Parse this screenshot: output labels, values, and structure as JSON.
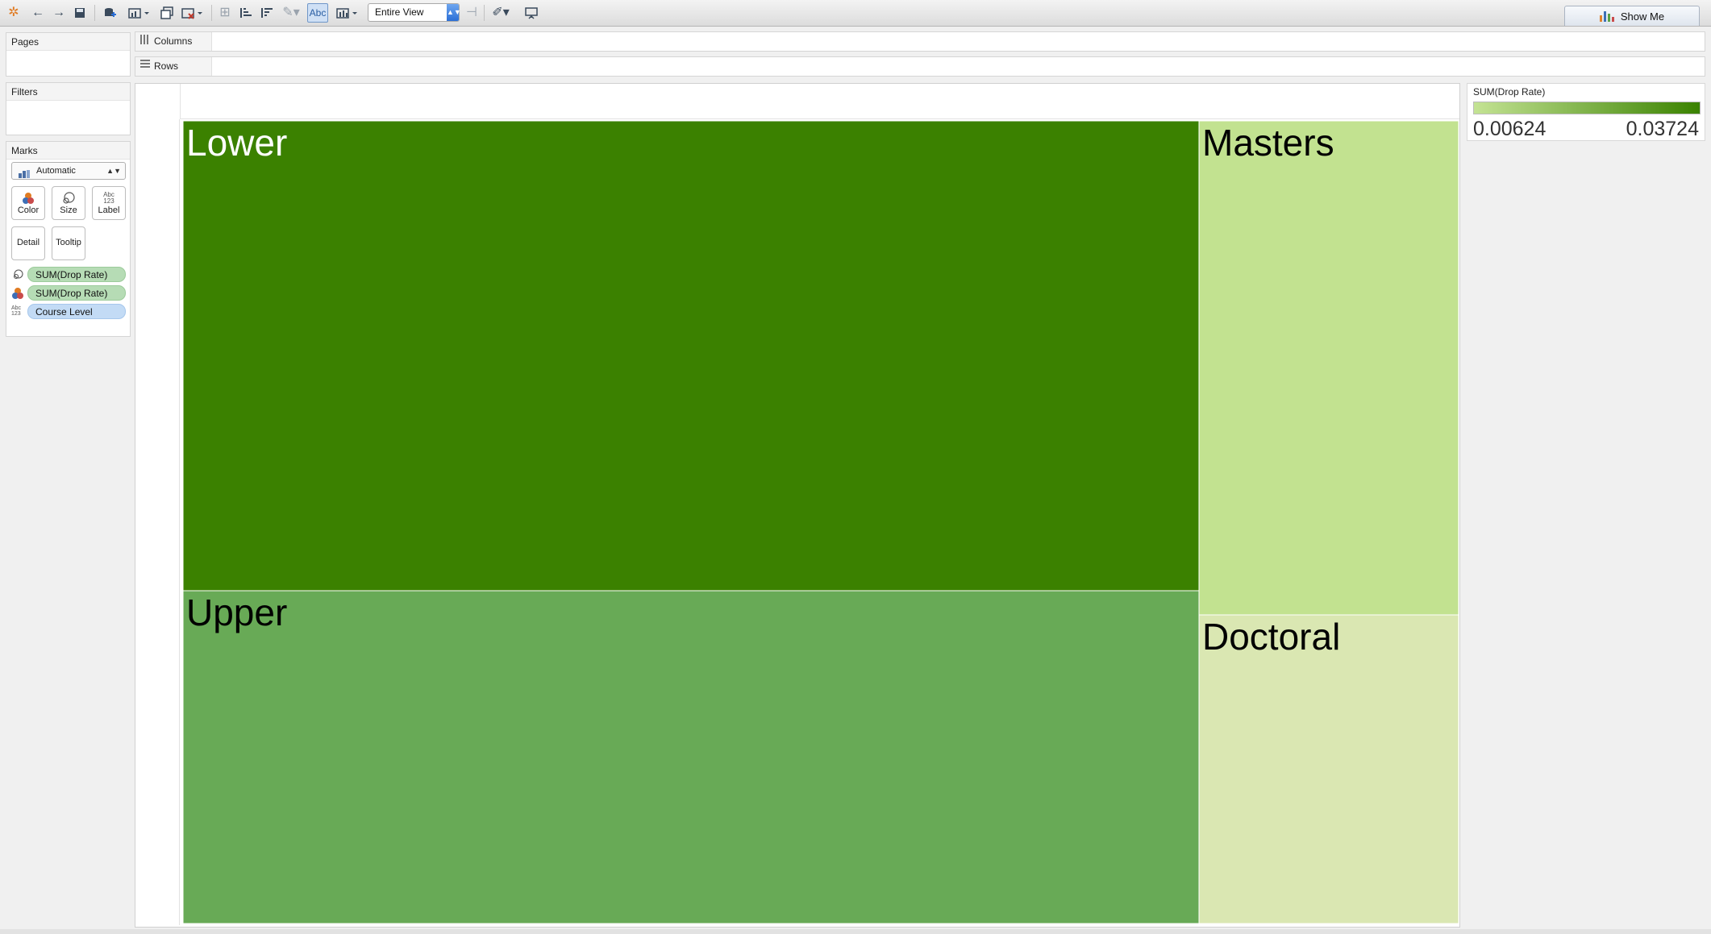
{
  "toolbar": {
    "fit_value": "Entire View",
    "abc_label": "Abc",
    "show_me_label": "Show Me",
    "icons": [
      "tableau-logo-icon",
      "undo-icon",
      "redo-icon",
      "save-icon",
      "new-datasource-icon",
      "new-worksheet-icon",
      "duplicate-icon",
      "clear-icon",
      "group-icon",
      "sort-ascending-icon",
      "sort-descending-icon",
      "highlight-icon",
      "show-labels-icon",
      "totals-icon",
      "fit-dropdown-icon",
      "pin-icon",
      "annotate-icon",
      "presentation-icon"
    ]
  },
  "cards": {
    "pages_title": "Pages",
    "filters_title": "Filters",
    "marks_title": "Marks",
    "mark_type": "Automatic",
    "buttons": {
      "color": "Color",
      "size": "Size",
      "label": "Label",
      "detail": "Detail",
      "tooltip": "Tooltip"
    },
    "label_icon_text": "Abc 123",
    "pills": [
      {
        "icon": "size-icon",
        "label": "SUM(Drop Rate)",
        "kind": "measure"
      },
      {
        "icon": "color-icon",
        "label": "SUM(Drop Rate)",
        "kind": "measure"
      },
      {
        "icon": "label-icon",
        "label": "Course Level",
        "kind": "dimension"
      }
    ]
  },
  "shelves": {
    "columns": "Columns",
    "rows": "Rows"
  },
  "legend": {
    "title": "SUM(Drop Rate)",
    "min": "0.00624",
    "max": "0.03724",
    "color_min": "#c4e394",
    "color_max": "#3a8200"
  },
  "chart_data": {
    "type": "treemap",
    "size_measure": "SUM(Drop Rate)",
    "color_measure": "SUM(Drop Rate)",
    "label_field": "Course Level",
    "color_range": [
      0.00624,
      0.03724
    ],
    "items": [
      {
        "label": "Lower",
        "value": 0.03724,
        "color": "#3b8100",
        "text_color": "#ffffff"
      },
      {
        "label": "Upper",
        "value": 0.0264,
        "color": "#68aa56",
        "text_color": "#000000"
      },
      {
        "label": "Masters",
        "value": 0.01,
        "color": "#c2e290",
        "text_color": "#000000"
      },
      {
        "label": "Doctoral",
        "value": 0.00624,
        "color": "#dae7b2",
        "text_color": "#000000"
      }
    ]
  }
}
